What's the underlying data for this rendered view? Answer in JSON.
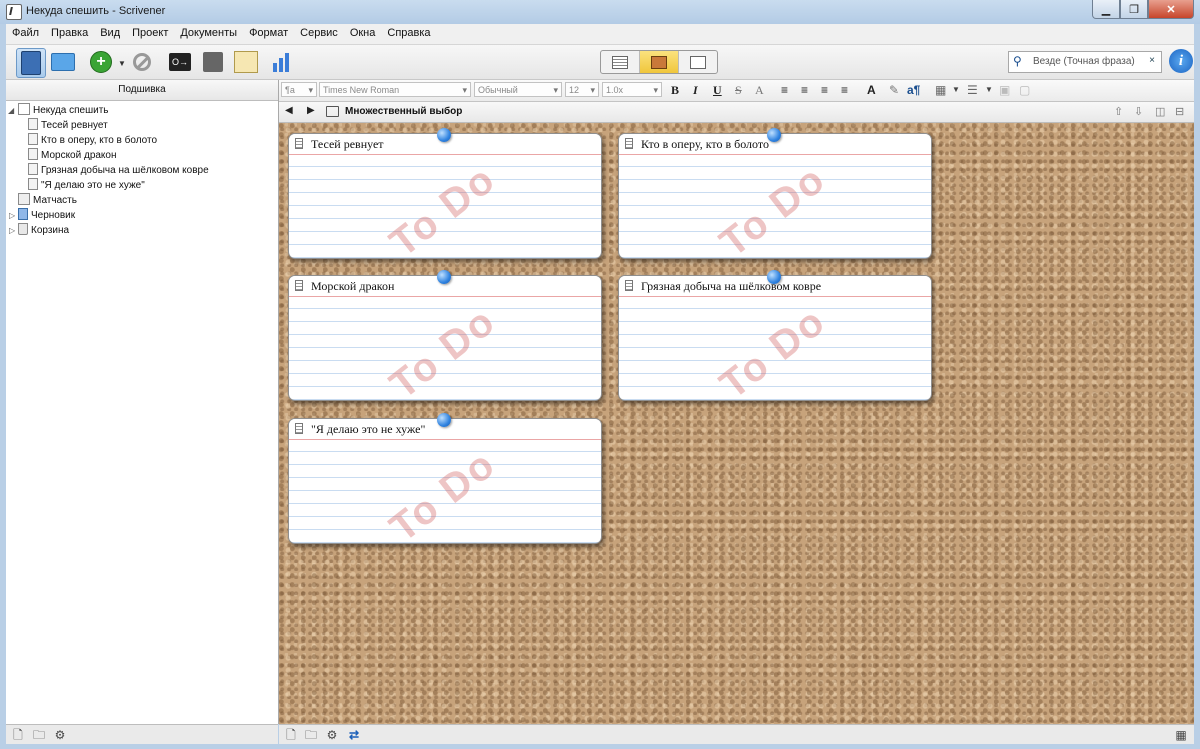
{
  "window": {
    "title": "Некуда спешить - Scrivener"
  },
  "menu": [
    "Файл",
    "Правка",
    "Вид",
    "Проект",
    "Документы",
    "Формат",
    "Сервис",
    "Окна",
    "Справка"
  ],
  "toolbar": {
    "search_placeholder": "Везде (Точная фраза)",
    "search_clear": "×",
    "info_label": "i",
    "key_label": "O→"
  },
  "binder": {
    "header": "Подшивка",
    "items": [
      {
        "label": "Некуда спешить",
        "level": 0,
        "icon": "project-icon"
      },
      {
        "label": "Тесей ревнует",
        "level": 1,
        "icon": "document-icon"
      },
      {
        "label": "Кто в оперу, кто в болото",
        "level": 1,
        "icon": "document-icon"
      },
      {
        "label": "Морской дракон",
        "level": 1,
        "icon": "document-icon"
      },
      {
        "label": "Грязная добыча на шёлковом ковре",
        "level": 1,
        "icon": "document-icon"
      },
      {
        "label": "\"Я делаю это не хуже\"",
        "level": 1,
        "icon": "document-icon"
      },
      {
        "label": "Матчасть",
        "level": 0,
        "icon": "research-folder-icon"
      },
      {
        "label": "Черновик",
        "level": 0,
        "icon": "draft-folder-icon"
      },
      {
        "label": "Корзина",
        "level": 0,
        "icon": "trash-icon"
      }
    ]
  },
  "formatbar": {
    "style_glyph": "¶a",
    "font": "Times New Roman",
    "typeface": "Обычный",
    "size": "12",
    "spacing": "1.0x",
    "bold": "B",
    "italic": "I",
    "underline": "U",
    "strike": "S",
    "superscript": "A"
  },
  "editor": {
    "title": "Множественный выбор",
    "cards": [
      {
        "title": "Тесей ревнует",
        "stamp": "To Do"
      },
      {
        "title": "Кто в оперу, кто в болото",
        "stamp": "To Do"
      },
      {
        "title": "Морской дракон",
        "stamp": "To Do"
      },
      {
        "title": "Грязная добыча на шёлковом ковре",
        "stamp": "To Do"
      },
      {
        "title": "\"Я делаю это не хуже\"",
        "stamp": "To Do"
      }
    ]
  },
  "colors": {
    "cork": "#c7a37b",
    "stamp": "#cd5a5a",
    "pin": "#2f82e0",
    "selected_view": "#f0c63b"
  }
}
